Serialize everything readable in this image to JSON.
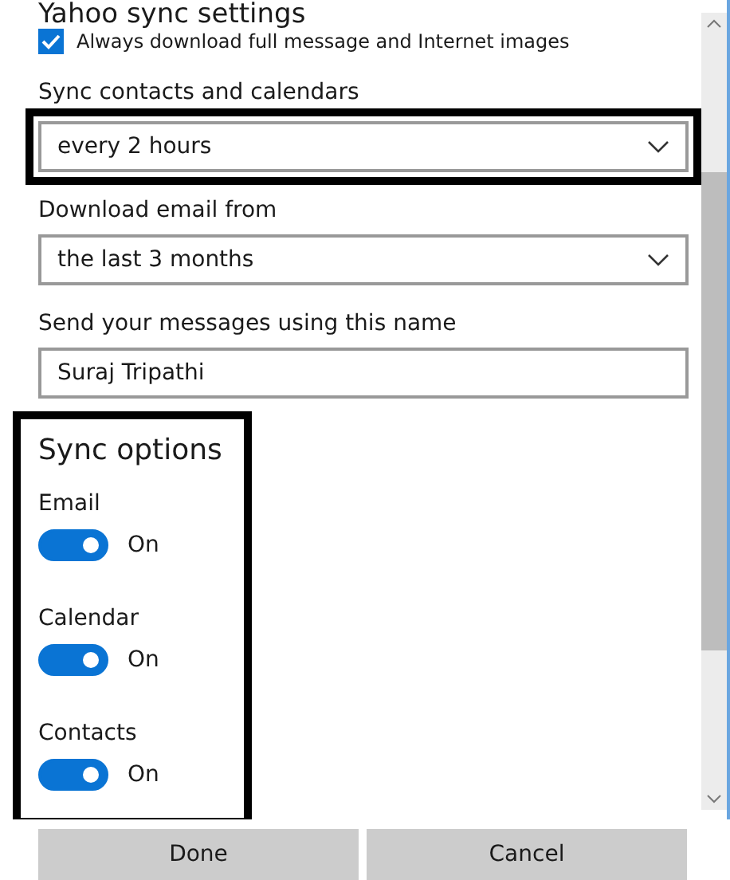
{
  "title": "Yahoo sync settings",
  "download_full": {
    "label": "Always download full message and Internet images",
    "checked": true
  },
  "fields": [
    {
      "kind": "dropdown",
      "label": "Sync contacts and calendars",
      "value": "every 2 hours",
      "highlighted": true
    },
    {
      "kind": "dropdown",
      "label": "Download email from",
      "value": "the last 3 months",
      "highlighted": false
    },
    {
      "kind": "text",
      "label": "Send your messages using this name",
      "value": "Suraj Tripathi",
      "highlighted": false
    }
  ],
  "sync_options": {
    "heading": "Sync options",
    "highlighted": true,
    "items": [
      {
        "label": "Email",
        "on": true,
        "state_text": "On"
      },
      {
        "label": "Calendar",
        "on": true,
        "state_text": "On"
      },
      {
        "label": "Contacts",
        "on": true,
        "state_text": "On"
      }
    ]
  },
  "buttons": [
    "Done",
    "Cancel"
  ]
}
